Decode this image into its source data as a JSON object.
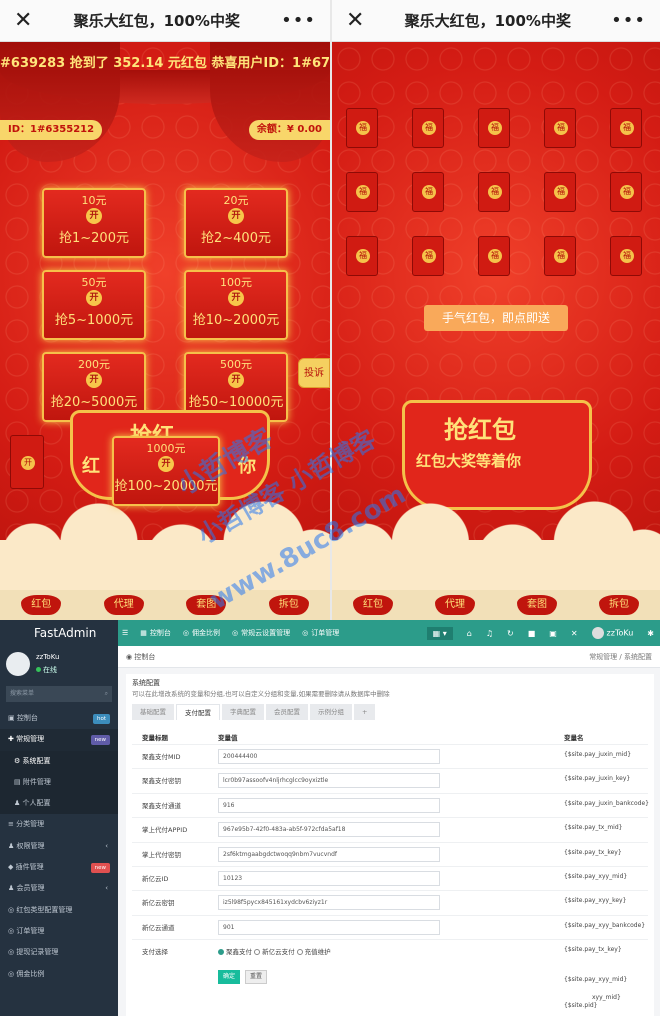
{
  "left_phone": {
    "title": "聚乐大红包，100%中奖",
    "close_glyph": "✕",
    "more_glyph": "•••",
    "marquee": "#639283 抢到了 352.14 元红包    恭喜用户ID：1#674",
    "user_id": "ID：1#6355212",
    "balance": "余额：¥ 0.00",
    "envelopes": [
      {
        "amount": "10元",
        "range": "抢1~200元"
      },
      {
        "amount": "20元",
        "range": "抢2~400元"
      },
      {
        "amount": "50元",
        "range": "抢5~1000元"
      },
      {
        "amount": "100元",
        "range": "抢10~2000元"
      },
      {
        "amount": "200元",
        "range": "抢20~5000元"
      },
      {
        "amount": "500元",
        "range": "抢50~10000元"
      },
      {
        "amount": "1000元",
        "range": "抢100~20000元"
      }
    ],
    "coin_glyph": "开",
    "complain_label": "投诉",
    "banner_left": "红",
    "banner_right": "你",
    "banner_top": "抢红",
    "nav": [
      "红包",
      "代理",
      "套图",
      "拆包"
    ]
  },
  "right_phone": {
    "title": "聚乐大红包，100%中奖",
    "close_glyph": "✕",
    "more_glyph": "•••",
    "mini_coin": "福",
    "action_label": "手气红包，即点即送",
    "banner_line1": "抢红包",
    "banner_line2": "红包大奖等着你",
    "nav": [
      "红包",
      "代理",
      "套图",
      "拆包"
    ]
  },
  "admin": {
    "brand": "FastAdmin",
    "top_nav": [
      {
        "icon": "dashboard-icon",
        "label": "控制台"
      },
      {
        "icon": "percent-icon",
        "label": "佣金比例"
      },
      {
        "icon": "settings-icon",
        "label": "常规云设置管理"
      },
      {
        "icon": "order-icon",
        "label": "订单管理"
      }
    ],
    "user": {
      "name": "zzToKu",
      "status": "在线"
    },
    "top_user": "zzToKu",
    "search_placeholder": "搜索菜单",
    "menu": [
      {
        "label": "控制台",
        "badge": "hot"
      },
      {
        "label": "常规管理",
        "badge": "new"
      },
      {
        "label": "系统配置",
        "sub": true,
        "selected": true
      },
      {
        "label": "附件管理",
        "sub": true
      },
      {
        "label": "个人配置",
        "sub": true
      },
      {
        "label": "分类管理"
      },
      {
        "label": "权限管理",
        "caret": "‹"
      },
      {
        "label": "插件管理",
        "badge": "new"
      },
      {
        "label": "会员管理",
        "caret": "‹"
      },
      {
        "label": "红包类型配置管理"
      },
      {
        "label": "订单管理"
      },
      {
        "label": "提现记录管理"
      },
      {
        "label": "佣金比例"
      }
    ],
    "breadcrumb_left": "控制台",
    "breadcrumb_right": "常规管理  /  系统配置",
    "panel_title": "系统配置",
    "panel_desc": "可以在此增改系统的变量和分组,也可以自定义分组和变量,如果需要删除请从数据库中删除",
    "tabs": [
      "基础配置",
      "支付配置",
      "字典配置",
      "会员配置",
      "示例分组",
      "+"
    ],
    "headers": {
      "title": "变量标题",
      "value": "变量值",
      "name": "变量名"
    },
    "rows": [
      {
        "title": "聚鑫支付MID",
        "value": "200444400",
        "name": "{$site.pay_juxin_mid}"
      },
      {
        "title": "聚鑫支付密钥",
        "value": "lcr0b97assoofv4nljrhcglcc9oyxiztle",
        "name": "{$site.pay_juxin_key}"
      },
      {
        "title": "聚鑫支付通道",
        "value": "916",
        "name": "{$site.pay_juxin_bankcode}"
      },
      {
        "title": "掌上代付APPID",
        "value": "967e95b7-42f0-483a-ab5f-972cfda5af18",
        "name": "{$site.pay_tx_mid}"
      },
      {
        "title": "掌上代付密钥",
        "value": "2sf6ktmgaabgdctwoqq9nbm7vucvndf",
        "name": "{$site.pay_tx_key}"
      },
      {
        "title": "新亿云ID",
        "value": "10123",
        "name": "{$site.pay_xyy_mid}"
      },
      {
        "title": "新亿云密钥",
        "value": "iz5l98f5pycx845161xydcbv6ziyz1r",
        "name": "{$site.pay_xyy_key}"
      },
      {
        "title": "新亿云通道",
        "value": "901",
        "name": "{$site.pay_xyy_bankcode}"
      }
    ],
    "pay_select": {
      "title": "支付选择",
      "options": [
        "聚鑫支付",
        "新亿云支付",
        "充值维护"
      ],
      "name": "{$site.pay_tx_key}"
    },
    "btn_ok": "确定",
    "btn_reset": "重置",
    "tail_vars": [
      "{$site.pay_xyy_mid}",
      "{$site.pid}",
      "xyy_mid}"
    ]
  },
  "watermark": {
    "line1": "小哲博客",
    "line2": "小哲博客 小哲博客",
    "line3": "www.8uc8.com"
  }
}
